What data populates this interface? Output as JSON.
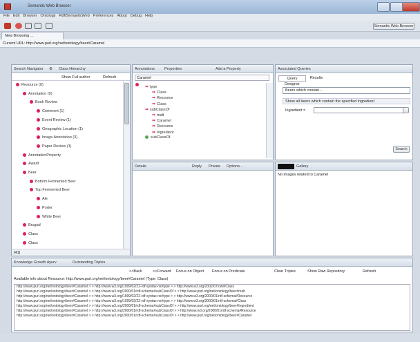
{
  "window": {
    "title": "Semantic Web Browser"
  },
  "menu": [
    "File",
    "Edit",
    "Browser",
    "Ontology",
    "Rdf/SemanticWeb",
    "Preferences",
    "About",
    "Debug",
    "Help"
  ],
  "toolbar": {
    "search_label": "Semantic Web Browser"
  },
  "tab": {
    "label": "New Browsing ..."
  },
  "url": {
    "label": "Current URL:",
    "value": "http://www.purl.org/net/ontology/beer#Caramel"
  },
  "left": {
    "tab1": "Search Navigator",
    "tab2": "Class Hierarchy",
    "show_full_author": "Show Full author",
    "refresh": "Refresh",
    "items": [
      {
        "label": "Resource (0)",
        "depth": 0,
        "icon": "pink"
      },
      {
        "label": "Annotation (0)",
        "depth": 1,
        "icon": "pink"
      },
      {
        "label": "Book Review",
        "depth": 2,
        "icon": "pink"
      },
      {
        "label": "Comment (1)",
        "depth": 3,
        "icon": "pink"
      },
      {
        "label": "Event Review (1)",
        "depth": 3,
        "icon": "pink"
      },
      {
        "label": "Geographic Location (1)",
        "depth": 3,
        "icon": "pink"
      },
      {
        "label": "Image Annotation (3)",
        "depth": 3,
        "icon": "pink"
      },
      {
        "label": "Paper Review (1)",
        "depth": 3,
        "icon": "pink"
      },
      {
        "label": "AnnotationProperty",
        "depth": 1,
        "icon": "pink"
      },
      {
        "label": "Award",
        "depth": 1,
        "icon": "pink"
      },
      {
        "label": "Beer",
        "depth": 1,
        "icon": "pink"
      },
      {
        "label": "Bottom Fermented Beer",
        "depth": 2,
        "icon": "pink"
      },
      {
        "label": "Top Fermented Beer",
        "depth": 2,
        "icon": "pink"
      },
      {
        "label": "Ale",
        "depth": 3,
        "icon": "pink"
      },
      {
        "label": "Porter",
        "depth": 3,
        "icon": "pink"
      },
      {
        "label": "White Beer",
        "depth": 3,
        "icon": "pink"
      },
      {
        "label": "Brugad",
        "depth": 1,
        "icon": "pink"
      },
      {
        "label": "Class",
        "depth": 1,
        "icon": "pink"
      },
      {
        "label": "Class",
        "depth": 1,
        "icon": "pink"
      }
    ],
    "scroll_label": "[41]"
  },
  "middle": {
    "tab1": "Annotations",
    "tab2": "Properties",
    "tab3": "Add a Property",
    "root": "Caramel",
    "tree": [
      {
        "label": "type",
        "depth": 1,
        "kind": "arrow"
      },
      {
        "label": "Class",
        "depth": 2,
        "kind": "arrow"
      },
      {
        "label": "Resource",
        "depth": 2,
        "kind": "arrow"
      },
      {
        "label": "Class",
        "depth": 2,
        "kind": "arrow"
      },
      {
        "label": "subClassOf",
        "depth": 1,
        "kind": "arrow"
      },
      {
        "label": "malt",
        "depth": 2,
        "kind": "arrow"
      },
      {
        "label": "Caramel",
        "depth": 2,
        "kind": "arrow"
      },
      {
        "label": "Resource",
        "depth": 2,
        "kind": "arrow"
      },
      {
        "label": "Ingredient",
        "depth": 2,
        "kind": "arrow"
      },
      {
        "label": "subClassOf",
        "depth": 1,
        "kind": "green"
      }
    ],
    "details": "Details",
    "reply": "Reply",
    "private": "Private",
    "options": "Options..."
  },
  "right": {
    "tab": "Associated Queries",
    "subtab1": "Query Designer",
    "subtab2": "Results",
    "dropdown": "Beers which contain...",
    "desc": "Show all beers which contain the specified ingredient",
    "field_label": "Ingredient =",
    "search": "Search",
    "gallery_tab": "Gallery",
    "gallery_msg": "No images related to Caramel"
  },
  "bottom": {
    "tab1": "Knowledge Growth Ayurv",
    "tab2": "Outstanding Triples",
    "actions": [
      "<<Back",
      "<<Forward",
      "Focus on Object",
      "Focus on Predicate",
      "Clear Triples",
      "Show Raw Repository",
      "Refresh"
    ],
    "header": "Available info about Resource: http://www.purl.org/net/ontology/beer#Caramel (Type: Class)",
    "rows": [
      "http://www.purl.org/net/ontology/beer#Caramel > > http://www.w3.org/1999/02/22-rdf-syntax-ns#type > > http://www.w3.org/2002/07/owl#Class",
      "http://www.purl.org/net/ontology/beer#Caramel > > http://www.w3.org/2000/01/rdf-schema#subClassOf > > http://www.purl.org/net/ontology/beer#malt",
      "http://www.purl.org/net/ontology/beer#Caramel > > http://www.w3.org/1999/02/22-rdf-syntax-ns#type > > http://www.w3.org/2000/01/rdf-schema#Resource",
      "http://www.purl.org/net/ontology/beer#Caramel > > http://www.w3.org/1999/02/22-rdf-syntax-ns#type > > http://www.w3.org/2000/01/rdf-schema#Class",
      "http://www.purl.org/net/ontology/beer#Caramel > > http://www.w3.org/2000/01/rdf-schema#subClassOf > > http://www.purl.org/net/ontology/beer#Ingredient",
      "http://www.purl.org/net/ontology/beer#Caramel > > http://www.w3.org/2000/01/rdf-schema#subClassOf > > http://www.w3.org/2000/01/rdf-schema#Resource",
      "http://www.purl.org/net/ontology/beer#Caramel > > http://www.w3.org/2000/01/rdf-schema#subClassOf > > http://www.purl.org/net/ontology/beer#Caramel"
    ]
  }
}
